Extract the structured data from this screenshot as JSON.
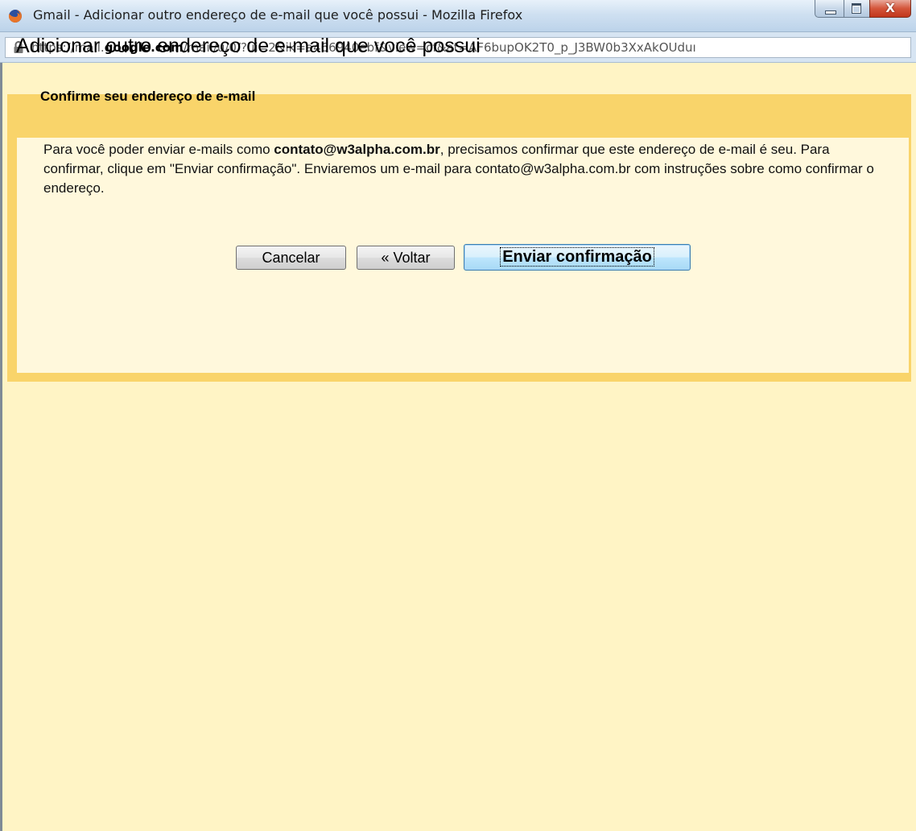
{
  "window": {
    "title": "Gmail - Adicionar outro endereço de e-mail que você possui - Mozilla Firefox",
    "controls": {
      "minimize_icon": "minimize-icon",
      "maximize_icon": "maximize-icon",
      "close_label": "X"
    }
  },
  "address_bar": {
    "url_prefix": "https://mail.",
    "url_domain": "google.com",
    "url_suffix": "/mail/u/0/?ui=2&ik=a466940ebf&view=cf&at=AF6bupOK2T0_p_J3BW0b3XxAkOUduı"
  },
  "dialog": {
    "title": "Adicionar outro endereço de e-mail que você possui",
    "section_title": "Confirme seu endereço de e-mail",
    "message": {
      "part1": "Para você poder enviar e-mails como ",
      "email_bold": "contato@w3alpha.com.br",
      "part2": ", precisamos confirmar que este endereço de e-mail é seu. Para confirmar, clique em \"Enviar confirmação\". Enviaremos um e-mail para contato@w3alpha.com.br com instruções sobre como confirmar o endereço."
    },
    "buttons": {
      "cancel": "Cancelar",
      "back": "« Voltar",
      "send": "Enviar confirmação"
    }
  },
  "colors": {
    "dialog_border": "#f9d46a",
    "dialog_background": "#fff8dc",
    "page_background": "#fff4c5"
  }
}
